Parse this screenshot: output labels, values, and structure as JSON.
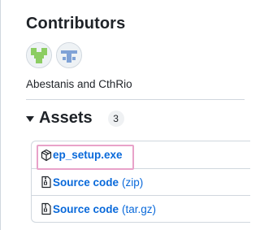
{
  "contributors": {
    "title": "Contributors",
    "avatars": [
      {
        "name": "Abestanis",
        "icon": "identicon-green-avatar",
        "color": "#8ccd63"
      },
      {
        "name": "CthRio",
        "icon": "identicon-blue-avatar",
        "color": "#7fa2d6"
      }
    ],
    "names_text": "Abestanis and CthRio"
  },
  "assets": {
    "title": "Assets",
    "count": "3",
    "items": [
      {
        "name": "ep_setup.exe",
        "suffix": "",
        "icon": "package-icon"
      },
      {
        "name": "Source code",
        "suffix": "(zip)",
        "icon": "file-zip-icon"
      },
      {
        "name": "Source code",
        "suffix": "(tar.gz)",
        "icon": "file-zip-icon"
      }
    ]
  },
  "colors": {
    "link": "#0969da",
    "highlight": "#e8a2c9",
    "border": "#d0d7de"
  }
}
